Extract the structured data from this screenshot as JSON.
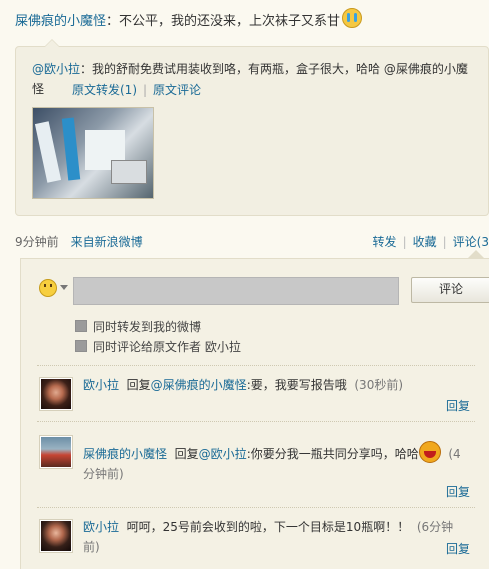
{
  "post": {
    "author": "屎佛痕的小魔怪",
    "text": "：不公平，我的还没来，上次袜子又系甘",
    "emoji": "cry-emoji"
  },
  "quote": {
    "author": "@欧小拉",
    "text": "：我的舒耐免费试用装收到咯，有两瓶，盒子很大，哈哈 @屎佛痕的小魔怪",
    "repost_label": "原文转发(1)",
    "comment_label": "原文评论"
  },
  "meta": {
    "time": "9分钟前",
    "source": "来自新浪微博",
    "repost": "转发",
    "favorite": "收藏",
    "comment": "评论(3"
  },
  "composer": {
    "input_value": "",
    "submit_label": "评论",
    "check_repost": "同时转发到我的微博",
    "check_comment_original": "同时评论给原文作者 欧小拉"
  },
  "comments": [
    {
      "author": "欧小拉",
      "reply_prefix": "回复",
      "mention": "@屎佛痕的小魔怪",
      "text": ":要，我要写报告哦",
      "time": "(30秒前)",
      "reply_label": "回复"
    },
    {
      "author": "屎佛痕的小魔怪",
      "reply_prefix": "回复",
      "mention": "@欧小拉",
      "text": ":你要分我一瓶共同分享吗，哈哈",
      "time": "(4分钟前)",
      "reply_label": "回复"
    },
    {
      "author": "欧小拉",
      "text": "呵呵，25号前会收到的啦，下一个目标是10瓶啊！！",
      "time": "(6分钟前)",
      "reply_label": "回复"
    }
  ]
}
